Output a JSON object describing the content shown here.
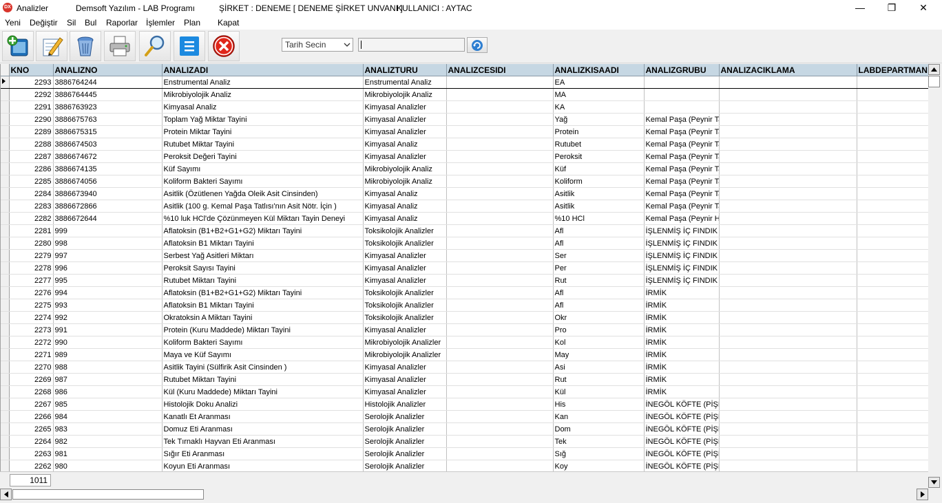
{
  "window": {
    "app_icon": "DX",
    "title": "Analizler",
    "program": "Demsoft Yazılım - LAB Programı",
    "company": "ŞİRKET : DENEME [ DENEME ŞİRKET UNVANI ]",
    "user": "KULLANICI : AYTAC",
    "minimize_glyph": "—",
    "restore_glyph": "❐",
    "close_glyph": "✕"
  },
  "menu": [
    "Yeni",
    "Değiştir",
    "Sil",
    "Bul",
    "Raporlar",
    "İşlemler",
    "Plan",
    "Kapat"
  ],
  "toolbar": {
    "icons": [
      "new-record-icon",
      "edit-icon",
      "delete-icon",
      "print-icon",
      "search-icon",
      "list-icon",
      "close-icon"
    ],
    "date_select": "Tarih Secin",
    "date_value": ""
  },
  "grid": {
    "columns": [
      "KNO",
      "ANALIZNO",
      "ANALIZADI",
      "ANALIZTURU",
      "ANALIZCESIDI",
      "ANALIZKISAADI",
      "ANALIZGRUBU",
      "ANALIZACIKLAMA",
      "LABDEPARTMAN"
    ],
    "rows": [
      [
        "2293",
        "3886764244",
        "Enstrumental Analiz",
        "Enstrumental Analiz",
        "",
        "EA",
        "",
        "",
        ""
      ],
      [
        "2292",
        "3886764445",
        "Mikrobiyolojik Analiz",
        "Mikrobiyolojik Analiz",
        "",
        "MA",
        "",
        "",
        ""
      ],
      [
        "2291",
        "3886763923",
        "Kimyasal Analiz",
        "Kimyasal Analizler",
        "",
        "KA",
        "",
        "",
        ""
      ],
      [
        "2290",
        "3886675763",
        "Toplam Yağ Miktar Tayini",
        "Kimyasal Analizler",
        "",
        "Yağ",
        "Kemal Paşa (Peynir Ta",
        "",
        ""
      ],
      [
        "2289",
        "3886675315",
        "Protein Miktar Tayini",
        "Kimyasal Analizler",
        "",
        "Protein",
        "Kemal Paşa (Peynir Ta",
        "",
        ""
      ],
      [
        "2288",
        "3886674503",
        "Rutubet Miktar Tayini",
        "Kimyasal Analiz",
        "",
        "Rutubet",
        "Kemal Paşa (Peynir Ta",
        "",
        ""
      ],
      [
        "2287",
        "3886674672",
        "Peroksit Değeri Tayini",
        "Kimyasal Analizler",
        "",
        "Peroksit",
        "Kemal Paşa (Peynir Ta",
        "",
        ""
      ],
      [
        "2286",
        "3886674135",
        "Küf Sayımı",
        "Mikrobiyolojik Analiz",
        "",
        "Küf",
        "Kemal Paşa (Peynir Ta",
        "",
        ""
      ],
      [
        "2285",
        "3886674056",
        "Koliform Bakteri Sayımı",
        "Mikrobiyolojik Analiz",
        "",
        "Koliform",
        "Kemal Paşa (Peynir Ta",
        "",
        ""
      ],
      [
        "2284",
        "3886673940",
        "Asitlik (Özütlenen Yağda Oleik Asit Cinsinden)",
        "Kimyasal Analiz",
        "",
        "Asitlik",
        "Kemal Paşa (Peynir Ta",
        "",
        ""
      ],
      [
        "2283",
        "3886672866",
        "Asitlik (100 g. Kemal Paşa Tatlısı'nın Asit Nötr. İçin )",
        "Kimyasal Analiz",
        "",
        "Asitlik",
        "Kemal Paşa (Peynir Ta",
        "",
        ""
      ],
      [
        "2282",
        "3886672644",
        "%10 luk HCl'de Çözünmeyen Kül Miktarı Tayin Deneyi",
        "Kimyasal Analiz",
        "",
        "%10 HCl",
        "Kemal Paşa (Peynir Ha",
        "",
        ""
      ],
      [
        "2281",
        "999",
        "Aflatoksin (B1+B2+G1+G2) Miktarı Tayini",
        "Toksikolojik Analizler",
        "",
        "Afl",
        "İŞLENMİŞ İÇ FINDIK",
        "",
        ""
      ],
      [
        "2280",
        "998",
        "Aflatoksin B1 Miktarı Tayini",
        "Toksikolojik Analizler",
        "",
        "Afl",
        "İŞLENMİŞ İÇ FINDIK",
        "",
        ""
      ],
      [
        "2279",
        "997",
        "Serbest Yağ Asitleri Miktarı",
        "Kimyasal Analizler",
        "",
        "Ser",
        "İŞLENMİŞ İÇ FINDIK",
        "",
        ""
      ],
      [
        "2278",
        "996",
        "Peroksit Sayısı Tayini",
        "Kimyasal Analizler",
        "",
        "Per",
        "İŞLENMİŞ İÇ FINDIK",
        "",
        ""
      ],
      [
        "2277",
        "995",
        "Rutubet Miktarı Tayini",
        "Kimyasal Analizler",
        "",
        "Rut",
        "İŞLENMİŞ İÇ FINDIK",
        "",
        ""
      ],
      [
        "2276",
        "994",
        "Aflatoksin (B1+B2+G1+G2) Miktarı Tayini",
        "Toksikolojik Analizler",
        "",
        "Afl",
        "İRMİK",
        "",
        ""
      ],
      [
        "2275",
        "993",
        "Aflatoksin B1 Miktarı Tayini",
        "Toksikolojik Analizler",
        "",
        "Afl",
        "İRMİK",
        "",
        ""
      ],
      [
        "2274",
        "992",
        "Okratoksin A Miktarı Tayini",
        "Toksikolojik Analizler",
        "",
        "Okr",
        "İRMİK",
        "",
        ""
      ],
      [
        "2273",
        "991",
        "Protein (Kuru Maddede) Miktarı Tayini",
        "Kimyasal Analizler",
        "",
        "Pro",
        "İRMİK",
        "",
        ""
      ],
      [
        "2272",
        "990",
        "Koliform Bakteri Sayımı",
        "Mikrobiyolojik Analizler",
        "",
        "Kol",
        "İRMİK",
        "",
        ""
      ],
      [
        "2271",
        "989",
        "Maya ve Küf Sayımı",
        "Mikrobiyolojik Analizler",
        "",
        "May",
        "İRMİK",
        "",
        ""
      ],
      [
        "2270",
        "988",
        "Asitlik Tayini (Sülfirik Asit Cinsinden )",
        "Kimyasal Analizler",
        "",
        "Asi",
        "İRMİK",
        "",
        ""
      ],
      [
        "2269",
        "987",
        "Rutubet Miktarı Tayini",
        "Kimyasal Analizler",
        "",
        "Rut",
        "İRMİK",
        "",
        ""
      ],
      [
        "2268",
        "986",
        "Kül (Kuru Maddede) Miktarı Tayini",
        "Kimyasal Analizler",
        "",
        "Kül",
        "İRMİK",
        "",
        ""
      ],
      [
        "2267",
        "985",
        "Histolojik Doku Analizi",
        "Histolojik Analizler",
        "",
        "His",
        "İNEGÖL KÖFTE (PİŞM",
        "",
        ""
      ],
      [
        "2266",
        "984",
        "Kanatlı Et  Aranması",
        "Serolojik Analizler",
        "",
        "Kan",
        "İNEGÖL KÖFTE (PİŞM",
        "",
        ""
      ],
      [
        "2265",
        "983",
        "Domuz Eti Aranması",
        "Serolojik Analizler",
        "",
        "Dom",
        "İNEGÖL KÖFTE (PİŞM",
        "",
        ""
      ],
      [
        "2264",
        "982",
        "Tek Tırnaklı Hayvan Eti Aranması",
        "Serolojik Analizler",
        "",
        "Tek",
        "İNEGÖL KÖFTE (PİŞM",
        "",
        ""
      ],
      [
        "2263",
        "981",
        "Sığır Eti Aranması",
        "Serolojik Analizler",
        "",
        "Sığ",
        "İNEGÖL KÖFTE (PİŞM",
        "",
        ""
      ],
      [
        "2262",
        "980",
        "Koyun Eti Aranması",
        "Serolojik Analizler",
        "",
        "Koy",
        "İNEGÖL KÖFTE (PİŞM",
        "",
        ""
      ]
    ]
  },
  "footer": {
    "record_count": "1011"
  }
}
